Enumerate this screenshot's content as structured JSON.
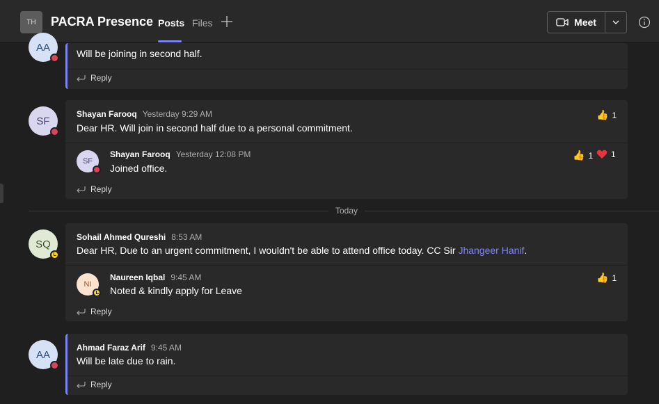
{
  "header": {
    "team_initials": "TH",
    "channel_name": "PACRA Presence",
    "tabs": [
      "Posts",
      "Files"
    ],
    "meet_label": "Meet"
  },
  "date_separator": "Today",
  "reply_label": "Reply",
  "threads": [
    {
      "initials": "AA",
      "text": "Will be joining in second half."
    },
    {
      "initials": "SF",
      "author": "Shayan Farooq",
      "time": "Yesterday 9:29 AM",
      "text": "Dear HR. Will join in second half due to a personal commitment.",
      "reaction_count": "1",
      "reply": {
        "initials": "SF",
        "author": "Shayan Farooq",
        "time": "Yesterday 12:08 PM",
        "text": "Joined office.",
        "like_count": "1",
        "heart_count": "1"
      }
    },
    {
      "initials": "SQ",
      "author": "Sohail Ahmed Qureshi",
      "time": "8:53 AM",
      "text": "Dear HR, Due to an urgent commitment, I wouldn't be able to attend office today. CC Sir",
      "mention": "Jhangeer Hanif",
      "text_end": ".",
      "reply": {
        "initials": "NI",
        "author": "Naureen Iqbal",
        "time": "9:45 AM",
        "text": "Noted & kindly apply for Leave",
        "like_count": "1"
      }
    },
    {
      "initials": "AA",
      "author": "Ahmad Faraz Arif",
      "time": "9:45 AM",
      "text": "Will be late due to rain."
    }
  ],
  "colors": {
    "accent": "#7f85f5",
    "busy": "#d74654",
    "away": "#f8d22a",
    "background": "#1f1f1f",
    "card": "#292929"
  }
}
